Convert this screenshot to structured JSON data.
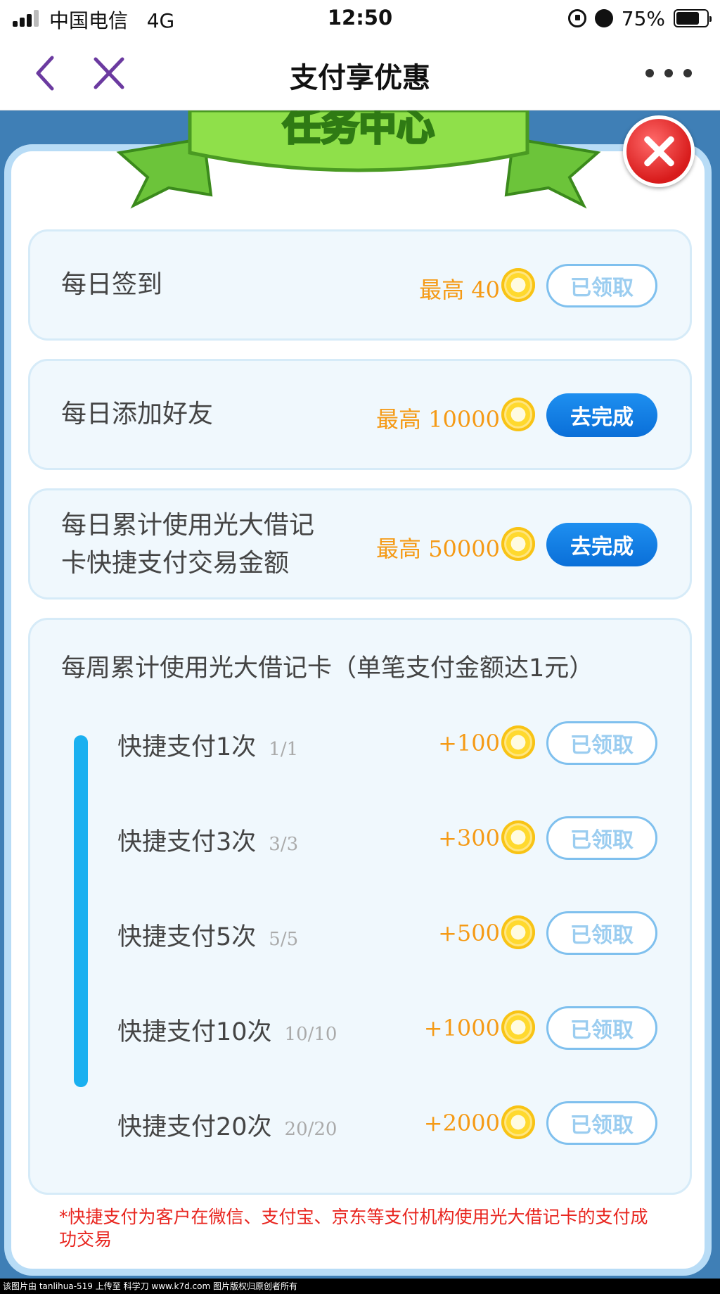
{
  "status_bar": {
    "carrier": "中国电信",
    "network": "4G",
    "time": "12:50",
    "battery": "75%",
    "icons": [
      "signal-icon",
      "rotation-lock-icon",
      "alarm-icon",
      "battery-icon"
    ]
  },
  "nav": {
    "title": "支付享优惠",
    "back_icon": "chevron-left-icon",
    "close_icon": "close-icon",
    "more_icon": "more-dots-icon"
  },
  "modal": {
    "banner_title": "任务中心",
    "tasks": [
      {
        "name": "每日签到",
        "reward": "最高 40",
        "button": "已领取",
        "state": "done"
      },
      {
        "name": "每日添加好友",
        "reward": "最高 10000",
        "button": "去完成",
        "state": "todo"
      },
      {
        "name_line1": "每日累计使用光大借记",
        "name_line2": "卡快捷支付交易金额",
        "reward": "最高 50000",
        "button": "去完成",
        "state": "todo"
      }
    ],
    "weekly": {
      "title": "每周累计使用光大借记卡（单笔支付金额达1元）",
      "rows": [
        {
          "label": "快捷支付1次",
          "progress": "1/1",
          "reward": "+100",
          "button": "已领取"
        },
        {
          "label": "快捷支付3次",
          "progress": "3/3",
          "reward": "+300",
          "button": "已领取"
        },
        {
          "label": "快捷支付5次",
          "progress": "5/5",
          "reward": "+500",
          "button": "已领取"
        },
        {
          "label": "快捷支付10次",
          "progress": "10/10",
          "reward": "+1000",
          "button": "已领取"
        },
        {
          "label": "快捷支付20次",
          "progress": "20/20",
          "reward": "+2000",
          "button": "已领取"
        }
      ]
    },
    "footnote": "*快捷支付为客户在微信、支付宝、京东等支付机构使用光大借记卡的支付成功交易"
  },
  "watermark": "该图片由 tanlihua-519 上传至 科学刀 www.k7d.com 图片版权归原创者所有",
  "colors": {
    "reward": "#f59a15",
    "primary_button": "#0a6fd8",
    "done_button_border": "#7fc0ee",
    "progress_bar": "#1ab0f0",
    "footnote": "#e8251f",
    "close_button": "#d81b1b"
  }
}
